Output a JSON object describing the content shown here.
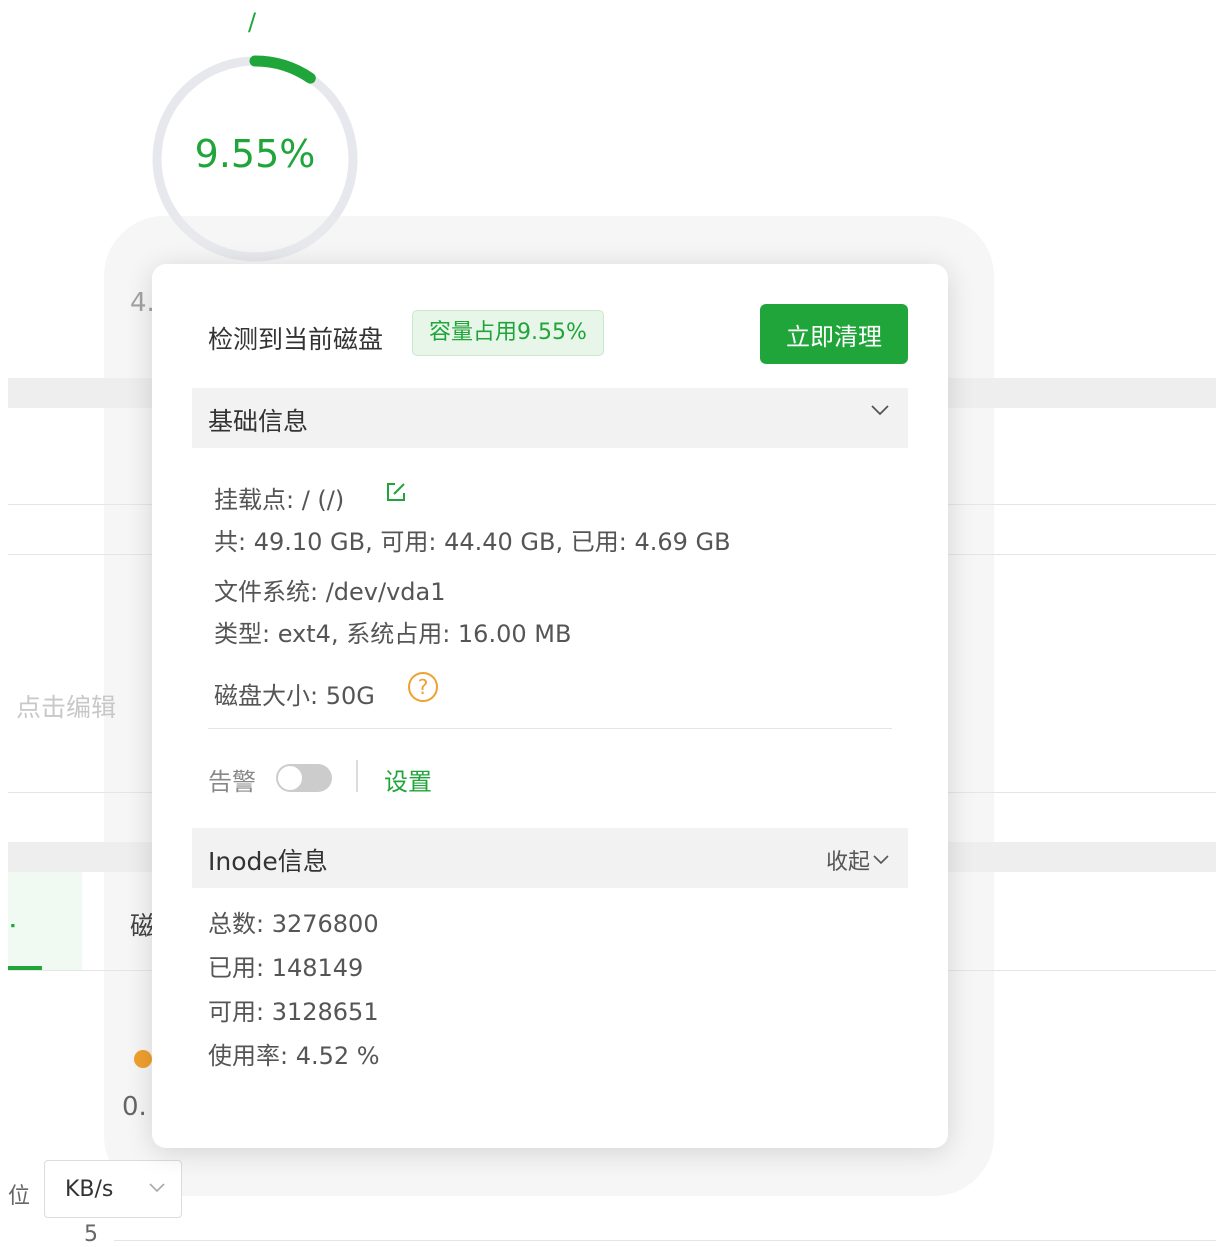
{
  "background": {
    "mount_label": "/",
    "usage_percent": 9.55,
    "usage_text": "9.55%",
    "partial_size": "4.",
    "edit_hint": "点击编辑",
    "tab_partial": "磁",
    "legend_value_partial": "0.",
    "unit_label_partial": "位",
    "unit_select": "KB/s",
    "axis_tick": "5"
  },
  "popover": {
    "header": {
      "title": "检测到当前磁盘",
      "tag": "容量占用9.55%",
      "clean_button": "立即清理"
    },
    "basic": {
      "title": "基础信息",
      "mount": "挂载点: / (/)",
      "capacity": "共: 49.10 GB, 可用: 44.40 GB, 已用: 4.69 GB",
      "filesystem": "文件系统: /dev/vda1",
      "type": "类型: ext4, 系统占用: 16.00 MB",
      "disk_size": "磁盘大小: 50G"
    },
    "alarm": {
      "label": "告警",
      "enabled": false,
      "setting_link": "设置"
    },
    "inode": {
      "title": "Inode信息",
      "collapse_label": "收起",
      "total": "总数: 3276800",
      "used": "已用: 148149",
      "available": "可用: 3128651",
      "usage": "使用率: 4.52 %"
    }
  },
  "colors": {
    "accent": "#20a53a",
    "warning": "#f0a030",
    "track": "#e6e8ee"
  }
}
